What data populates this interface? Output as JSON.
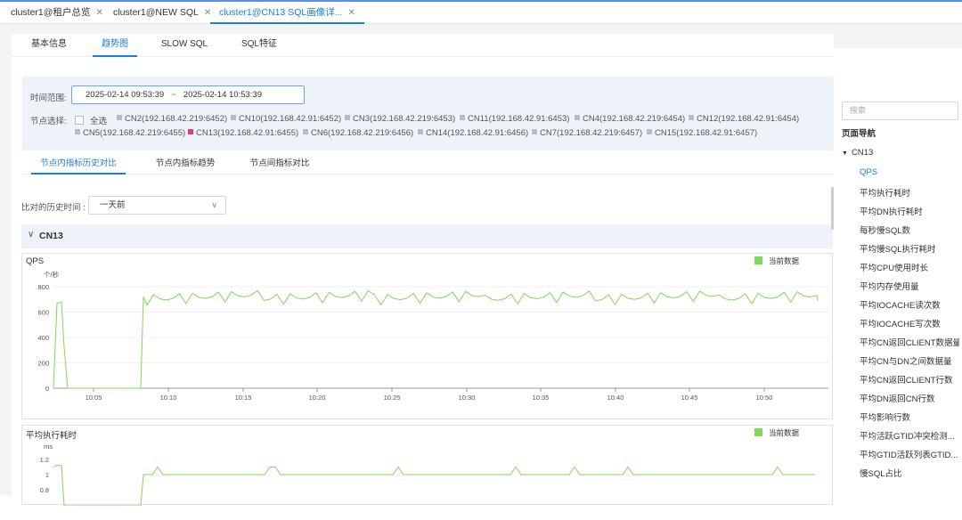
{
  "tabs": [
    {
      "label": "cluster1@租户总览"
    },
    {
      "label": "cluster1@NEW SQL"
    },
    {
      "label": "cluster1@CN13 SQL画像详..."
    }
  ],
  "subtabs": [
    {
      "label": "基本信息"
    },
    {
      "label": "趋势图"
    },
    {
      "label": "SLOW SQL"
    },
    {
      "label": "SQL特征"
    }
  ],
  "filters": {
    "time_label": "时间范围:",
    "start": "2025-02-14 09:53:39",
    "sep": "~",
    "end": "2025-02-14 10:53:39",
    "node_label": "节点选择:",
    "all_label": "全选",
    "nodes": [
      {
        "label": "CN2(192.168.42.219:6452)",
        "color": "#b8bcc2"
      },
      {
        "label": "CN10(192.168.42.91:6452)",
        "color": "#b8bcc2"
      },
      {
        "label": "CN3(192.168.42.219:6453)",
        "color": "#b8bcc2"
      },
      {
        "label": "CN11(192.168.42.91:6453)",
        "color": "#b8bcc2"
      },
      {
        "label": "CN4(192.168.42.219:6454)",
        "color": "#b8bcc2"
      },
      {
        "label": "CN12(192.168.42.91:6454)",
        "color": "#b8bcc2"
      },
      {
        "label": "CN5(192.168.42.219:6455)",
        "color": "#b8bcc2"
      },
      {
        "label": "CN13(192.168.42.91:6455)",
        "color": "#e8368f"
      },
      {
        "label": "CN6(192.168.42.219:6456)",
        "color": "#b8bcc2"
      },
      {
        "label": "CN14(192.168.42.91:6456)",
        "color": "#b8bcc2"
      },
      {
        "label": "CN7(192.168.42.219:6457)",
        "color": "#b8bcc2"
      },
      {
        "label": "CN15(192.168.42.91:6457)",
        "color": "#b8bcc2"
      }
    ]
  },
  "inner_tabs": [
    {
      "label": "节点内指标历史对比"
    },
    {
      "label": "节点内指标趋势"
    },
    {
      "label": "节点间指标对比"
    }
  ],
  "compare": {
    "label": "比对的历史时间 :",
    "value": "一天前"
  },
  "section": {
    "title": "CN13"
  },
  "charts": [
    {
      "title": "QPS",
      "legend": "当前数据",
      "unit": "个/秒",
      "ylim": [
        0,
        800
      ],
      "yticks": [
        0,
        200,
        400,
        600,
        800
      ],
      "xticks": [
        "10:05",
        "10:10",
        "10:15",
        "10:20",
        "10:25",
        "10:30",
        "10:35",
        "10:40",
        "10:45",
        "10:50"
      ],
      "chart_data": {
        "type": "line",
        "series": [
          {
            "name": "当前数据",
            "color": "#7ed957"
          }
        ],
        "xrange": [
          "09:53",
          "10:53"
        ],
        "ylim": [
          0,
          800
        ],
        "shape": "~0 for 09:53-09:54 with spike to ~690, 0 until ~10:08, then ~700-780 oscillating"
      }
    },
    {
      "title": "平均执行耗时",
      "legend": "当前数据",
      "unit": "ms",
      "ylim": [
        0.8,
        1.2
      ],
      "yticks": [
        1.2,
        1,
        0.8
      ],
      "xticks": [],
      "chart_data": {
        "type": "line",
        "series": [
          {
            "name": "当前数据",
            "color": "#7ed957"
          }
        ],
        "ylim": [
          0.8,
          1.2
        ],
        "shape": "~1.15 spike at start, 0 until ~10:08, then ~1.0 with occasional ~1.1 spikes"
      }
    }
  ],
  "side": {
    "search_placeholder": "搜索",
    "nav_title": "页面导航",
    "group": "CN13",
    "items": [
      "QPS",
      "平均执行耗时",
      "平均DN执行耗时",
      "每秒慢SQL数",
      "平均慢SQL执行耗时",
      "平均CPU使用时长",
      "平均内存使用量",
      "平均IOCACHE读次数",
      "平均IOCACHE写次数",
      "平均CN返回CLIENT数据量",
      "平均CN与DN之间数据量",
      "平均CN返回CLIENT行数",
      "平均DN返回CN行数",
      "平均影响行数",
      "平均活跃GTID冲突检测...",
      "平均GTID活跃列表GTID...",
      "慢SQL占比"
    ]
  }
}
